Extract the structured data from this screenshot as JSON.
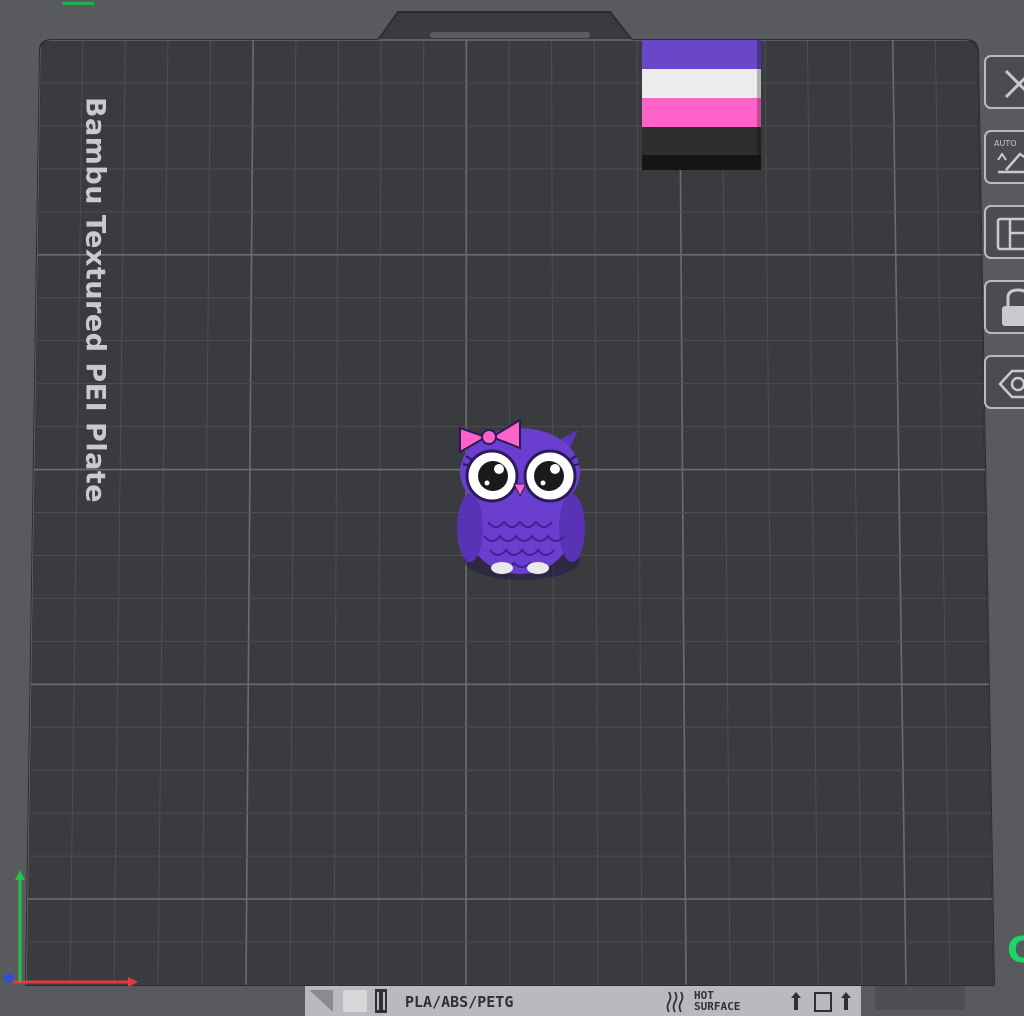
{
  "app": {
    "view": "3D prepare view"
  },
  "plate": {
    "label": "Bambu Textured PEI Plate",
    "grid_cells": 22
  },
  "objects": [
    {
      "name": "owl",
      "colors": {
        "body": "#6a3fd0",
        "bow": "#ff62c8",
        "eye": "#ffffff"
      }
    },
    {
      "name": "flag-stack",
      "stripes": [
        "#6a46c9",
        "#ececec",
        "#ff62c8",
        "#2e2e2e"
      ]
    }
  ],
  "toolbar": {
    "items": [
      {
        "name": "close-icon"
      },
      {
        "name": "auto-orient-icon",
        "badge": "AUTO"
      },
      {
        "name": "arrange-icon"
      },
      {
        "name": "lock-icon"
      },
      {
        "name": "cut-icon"
      }
    ]
  },
  "footer": {
    "material_label": "PLA/ABS/PETG",
    "hot_label": "HOT",
    "surface_label": "SURFACE"
  },
  "axes": {
    "x_color": "#e23b3b",
    "y_color": "#27c24a",
    "z_color": "#2f4fd0"
  },
  "corner_label": "C"
}
